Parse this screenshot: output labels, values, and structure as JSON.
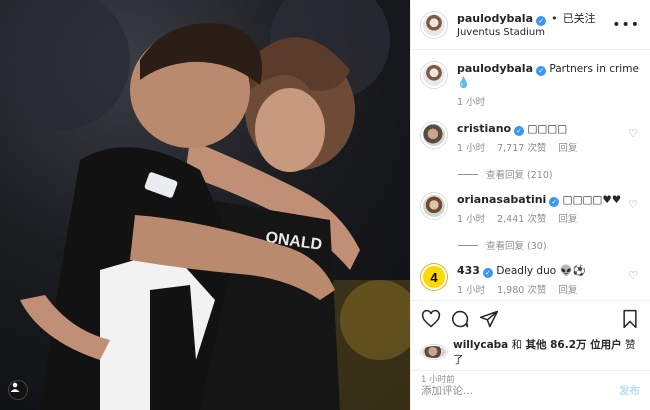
{
  "header": {
    "username": "paulodybala",
    "follow_separator": "•",
    "follow_label": "已关注",
    "location": "Juventus Stadium",
    "more_label": "•••"
  },
  "caption": {
    "username": "paulodybala",
    "text": "Partners in crime 💧",
    "time": "1 小时"
  },
  "comments": [
    {
      "username": "cristiano",
      "text": "□□□□",
      "time": "1 小时",
      "likes": "7,717 次赞",
      "reply": "回复",
      "view_replies": "查看回复 (210)"
    },
    {
      "username": "orianasabatini",
      "text": "□□□□♥♥",
      "time": "1 小时",
      "likes": "2,441 次赞",
      "reply": "回复",
      "view_replies": "查看回复 (30)"
    },
    {
      "username": "433",
      "avatar_text": "4",
      "text": "Deadly duo 👽⚽",
      "time": "1 小时",
      "likes": "1,980 次赞",
      "reply": "回复"
    }
  ],
  "likes": {
    "user": "willycaba",
    "joiner": "和",
    "others": "其他 86.2万 位用户",
    "suffix": "赞了"
  },
  "time_ago": "1 小时前",
  "add_comment": {
    "placeholder": "添加评论...",
    "post_label": "发布"
  },
  "icons": {
    "heart": "heart-icon",
    "comment": "comment-icon",
    "share": "share-icon",
    "save": "bookmark-icon",
    "tag": "user-tag-icon"
  },
  "colors": {
    "verified": "#3897f0",
    "muted": "#8e8e8e",
    "post_disabled": "#b2dffc",
    "jersey_black": "#111111",
    "jersey_white": "#f2f2f2"
  }
}
